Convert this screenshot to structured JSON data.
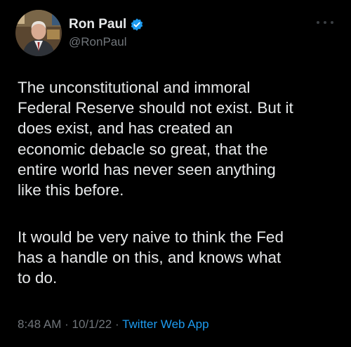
{
  "author": {
    "display_name": "Ron Paul",
    "handle": "@RonPaul",
    "verified": true,
    "verified_color": "#1d9bf0",
    "avatar_icon": "profile-photo"
  },
  "tweet": {
    "paragraphs": [
      "The unconstitutional and immoral\nFederal Reserve should not exist. But it\ndoes exist, and has created an\neconomic debacle so great, that the\nentire world has never seen anything\nlike this before.",
      "It would be very naive to think the Fed\nhas a handle on this, and knows what\nto do."
    ],
    "time": "8:48 AM",
    "date": "10/1/22",
    "separator": "·",
    "source": "Twitter Web App"
  },
  "theme": {
    "background": "#000000",
    "text": "#e7e9ea",
    "secondary_text": "#71767b",
    "link": "#1d9bf0"
  },
  "icons": {
    "more": "more-options-icon",
    "verified": "verified-badge-icon"
  }
}
